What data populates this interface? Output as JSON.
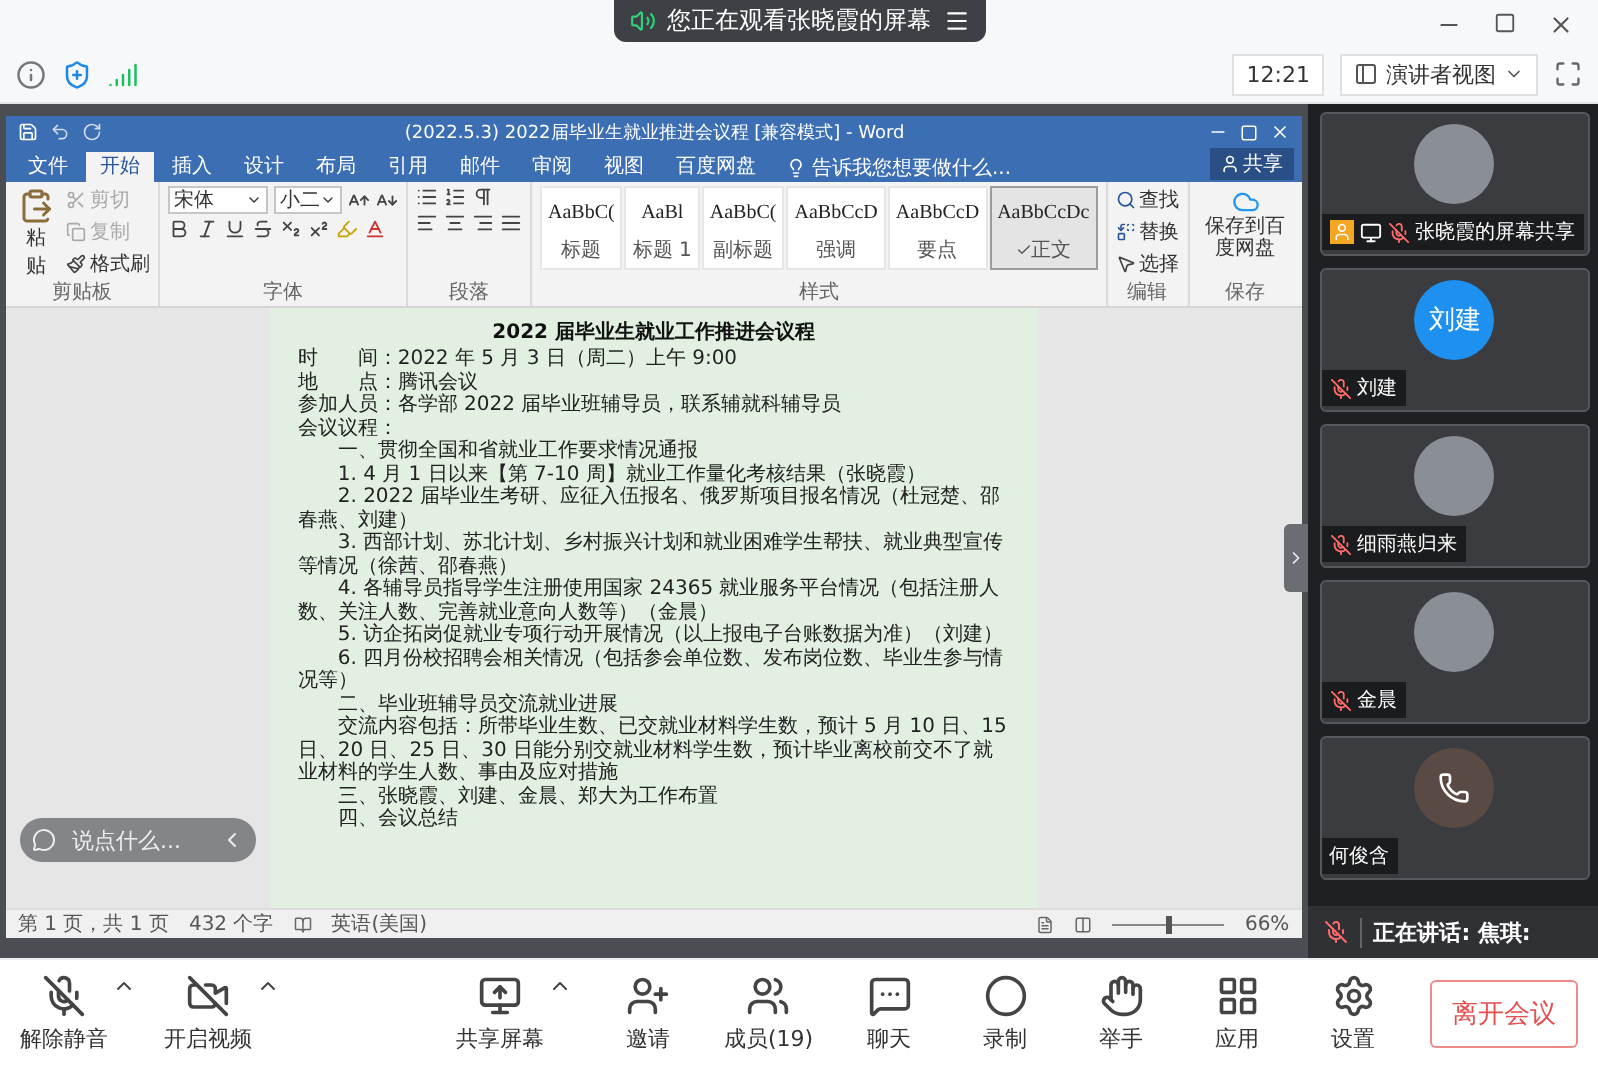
{
  "meeting": {
    "banner": "您正在观看张晓霞的屏幕",
    "time": "12:21",
    "view_mode": "演讲者视图"
  },
  "word": {
    "title": "(2022.5.3)  2022届毕业生就业推进会议程 [兼容模式] - Word",
    "tabs": [
      {
        "label": "文件",
        "selected": false
      },
      {
        "label": "开始",
        "selected": true
      },
      {
        "label": "插入",
        "selected": false
      },
      {
        "label": "设计",
        "selected": false
      },
      {
        "label": "布局",
        "selected": false
      },
      {
        "label": "引用",
        "selected": false
      },
      {
        "label": "邮件",
        "selected": false
      },
      {
        "label": "审阅",
        "selected": false
      },
      {
        "label": "视图",
        "selected": false
      },
      {
        "label": "百度网盘",
        "selected": false
      }
    ],
    "tell_me": "告诉我您想要做什么...",
    "share": "共享",
    "clipboard": {
      "paste": "粘贴",
      "label": "剪贴板",
      "items": [
        {
          "kind": "cut",
          "label": "剪切",
          "disabled": true
        },
        {
          "kind": "copy",
          "label": "复制",
          "disabled": true
        },
        {
          "kind": "painter",
          "label": "格式刷",
          "disabled": false
        }
      ]
    },
    "font": {
      "name": "宋体",
      "size": "小二",
      "label": "字体"
    },
    "paragraph": {
      "label": "段落"
    },
    "styles": {
      "label": "样式",
      "items": [
        {
          "preview": "AaBbC(",
          "name": "标题",
          "selected": false
        },
        {
          "preview": "AaBl",
          "name": "标题 1",
          "selected": false
        },
        {
          "preview": "AaBbC(",
          "name": "副标题",
          "selected": false
        },
        {
          "preview": "AaBbCcD",
          "name": "强调",
          "selected": false
        },
        {
          "preview": "AaBbCcD",
          "name": "要点",
          "selected": false
        },
        {
          "preview": "AaBbCcDc",
          "name": "正文",
          "selected": true
        }
      ]
    },
    "editing": {
      "label": "编辑",
      "items": [
        {
          "kind": "find",
          "label": "查找"
        },
        {
          "kind": "replace",
          "label": "替换"
        },
        {
          "kind": "select",
          "label": "选择"
        }
      ]
    },
    "save": {
      "button": "保存到百度网盘",
      "label": "保存"
    },
    "document": {
      "title": "2022 届毕业生就业工作推进会议程",
      "paragraphs": [
        {
          "kind": "plain",
          "text": "时　　间：2022 年 5 月 3 日（周二）上午 9:00"
        },
        {
          "kind": "plain",
          "text": "地　　点：腾讯会议"
        },
        {
          "kind": "plain",
          "text": "参加人员：各学部 2022 届毕业班辅导员，联系辅就科辅导员"
        },
        {
          "kind": "plain",
          "text": "会议议程："
        },
        {
          "kind": "indent",
          "text": "一、贯彻全国和省就业工作要求情况通报"
        },
        {
          "kind": "indent",
          "text": "1. 4 月 1 日以来【第 7-10 周】就业工作量化考核结果（张晓霞）"
        },
        {
          "kind": "indent",
          "text": "2. 2022 届毕业生考研、应征入伍报名、俄罗斯项目报名情况（杜冠楚、邵春燕、刘建）"
        },
        {
          "kind": "indent",
          "text": "3. 西部计划、苏北计划、乡村振兴计划和就业困难学生帮扶、就业典型宣传等情况（徐茜、邵春燕）"
        },
        {
          "kind": "indent",
          "text": "4. 各辅导员指导学生注册使用国家 24365 就业服务平台情况（包括注册人数、关注人数、完善就业意向人数等）（金晨）"
        },
        {
          "kind": "indent",
          "text": "5. 访企拓岗促就业专项行动开展情况（以上报电子台账数据为准）（刘建）"
        },
        {
          "kind": "indent",
          "text": "6. 四月份校招聘会相关情况（包括参会单位数、发布岗位数、毕业生参与情况等）"
        },
        {
          "kind": "indent",
          "text": "二、毕业班辅导员交流就业进展"
        },
        {
          "kind": "indent",
          "text": "交流内容包括：所带毕业生数、已交就业材料学生数，预计 5 月 10 日、15 日、20 日、25 日、30 日能分别交就业材料学生数，预计毕业离校前交不了就业材料的学生人数、事由及应对措施"
        },
        {
          "kind": "indent",
          "text": "三、张晓霞、刘建、金晨、郑大为工作布置"
        },
        {
          "kind": "indent",
          "text": "四、会议总结"
        }
      ]
    },
    "status": {
      "page": "第 1 页，共 1 页",
      "words": "432 个字",
      "language": "英语(美国)",
      "zoom": "66%",
      "zoom_slider": {
        "level": 0.5
      }
    }
  },
  "chat_input": {
    "placeholder": "说点什么..."
  },
  "participants": [
    {
      "name": "张晓霞的屏幕共享",
      "kind": "photo",
      "muted": true,
      "host": true
    },
    {
      "name": "刘建",
      "kind": "initials",
      "initials": "刘建",
      "muted": true,
      "host": false
    },
    {
      "name": "细雨燕归来",
      "kind": "photo",
      "muted": true,
      "host": false
    },
    {
      "name": "金晨",
      "kind": "photo",
      "muted": true,
      "host": false
    },
    {
      "name": "何俊含",
      "kind": "phone",
      "muted": false,
      "host": false
    }
  ],
  "speaking": {
    "label": "正在讲话: 焦琪:",
    "muted": true
  },
  "toolbar": {
    "left": [
      {
        "kind": "mic",
        "label": "解除静音",
        "off": true,
        "menu": true
      },
      {
        "kind": "video",
        "label": "开启视频",
        "off": true,
        "menu": true
      }
    ],
    "center": [
      {
        "kind": "share",
        "label": "共享屏幕",
        "menu": true
      },
      {
        "kind": "invite",
        "label": "邀请",
        "menu": false
      },
      {
        "kind": "members",
        "label": "成员(19)",
        "menu": false
      },
      {
        "kind": "chat",
        "label": "聊天",
        "menu": false
      },
      {
        "kind": "record",
        "label": "录制",
        "menu": false
      },
      {
        "kind": "hand",
        "label": "举手",
        "menu": false
      },
      {
        "kind": "apps",
        "label": "应用",
        "menu": false
      },
      {
        "kind": "settings",
        "label": "设置",
        "menu": false
      }
    ],
    "leave": "离开会议"
  }
}
